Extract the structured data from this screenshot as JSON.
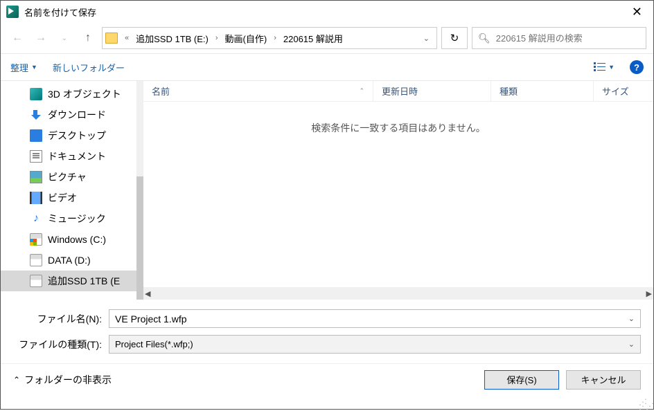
{
  "title": "名前を付けて保存",
  "breadcrumb": {
    "seg1": "追加SSD 1TB (E:)",
    "seg2": "動画(自作)",
    "seg3": "220615 解説用"
  },
  "search": {
    "placeholder": "220615 解説用の検索"
  },
  "toolbar": {
    "organize": "整理",
    "newfolder": "新しいフォルダー"
  },
  "sidebar": {
    "items": [
      {
        "label": "3D オブジェクト"
      },
      {
        "label": "ダウンロード"
      },
      {
        "label": "デスクトップ"
      },
      {
        "label": "ドキュメント"
      },
      {
        "label": "ピクチャ"
      },
      {
        "label": "ビデオ"
      },
      {
        "label": "ミュージック"
      },
      {
        "label": "Windows (C:)"
      },
      {
        "label": "DATA (D:)"
      },
      {
        "label": "追加SSD 1TB (E"
      }
    ]
  },
  "columns": {
    "name": "名前",
    "date": "更新日時",
    "type": "種類",
    "size": "サイズ"
  },
  "empty_msg": "検索条件に一致する項目はありません。",
  "filename_label": "ファイル名(N):",
  "filename_value": "VE Project 1.wfp",
  "filetype_label": "ファイルの種類(T):",
  "filetype_value": "Project Files(*.wfp;)",
  "hide_folders": "フォルダーの非表示",
  "save_btn": "保存(S)",
  "cancel_btn": "キャンセル"
}
